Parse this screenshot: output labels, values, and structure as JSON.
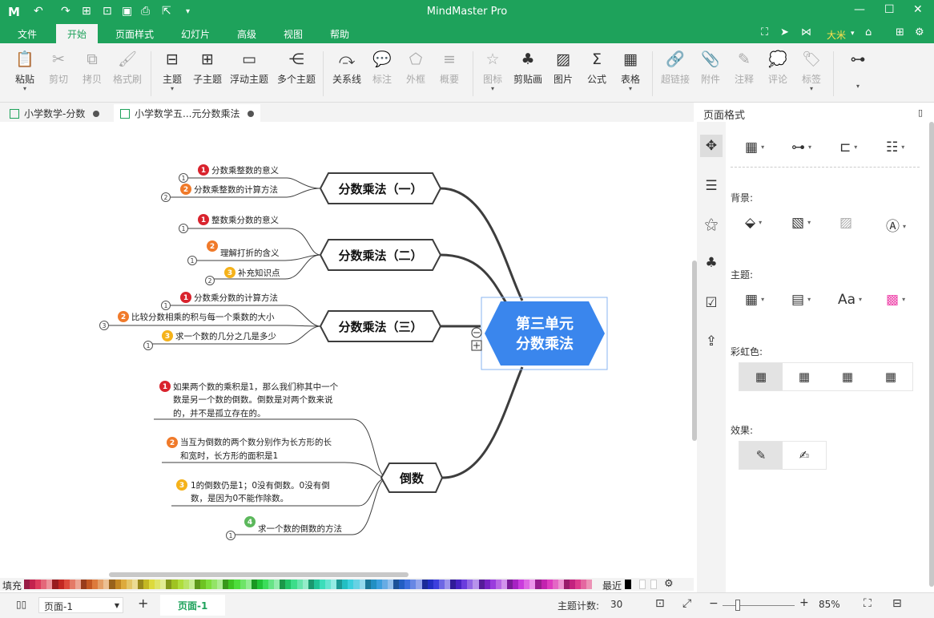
{
  "app": {
    "title": "MindMaster Pro",
    "user": "大米"
  },
  "menu": {
    "items": [
      "文件",
      "开始",
      "页面样式",
      "幻灯片",
      "高级",
      "视图",
      "帮助"
    ]
  },
  "ribbon": {
    "buttons": [
      "粘贴",
      "剪切",
      "拷贝",
      "格式刷",
      "主题",
      "子主题",
      "浮动主题",
      "多个主题",
      "关系线",
      "标注",
      "外框",
      "概要",
      "图标",
      "剪贴画",
      "图片",
      "公式",
      "表格",
      "超链接",
      "附件",
      "注释",
      "评论",
      "标签"
    ]
  },
  "tabs": [
    "小学数学-分数",
    "小学数学五...元分数乘法"
  ],
  "map": {
    "root": {
      "line1": "第三单元",
      "line2": "分数乘法"
    },
    "branches": [
      {
        "label": "分数乘法（一）",
        "items": [
          {
            "num": "1",
            "text": "分数乘整数的意义",
            "count": "1"
          },
          {
            "num": "2",
            "text": "分数乘整数的计算方法",
            "count": "2"
          }
        ]
      },
      {
        "label": "分数乘法（二）",
        "items": [
          {
            "num": "1",
            "text": "整数乘分数的意义",
            "count": "1"
          },
          {
            "num": "2",
            "text": "理解打折的含义",
            "count": "1"
          },
          {
            "num": "3",
            "text": "补充知识点",
            "count": "2"
          }
        ]
      },
      {
        "label": "分数乘法（三）",
        "items": [
          {
            "num": "1",
            "text": "分数乘分数的计算方法",
            "count": "1"
          },
          {
            "num": "2",
            "text": "比较分数相乘的积与每一个乘数的大小",
            "count": "3"
          },
          {
            "num": "3",
            "text": "求一个数的几分之几是多少",
            "count": "1"
          }
        ]
      },
      {
        "label": "倒数",
        "items": [
          {
            "num": "1",
            "lines": [
              "如果两个数的乘积是1，那么我们称其中一个",
              "数是另一个数的倒数。倒数是对两个数来说",
              "的，并不是孤立存在的。"
            ]
          },
          {
            "num": "2",
            "lines": [
              "当互为倒数的两个数分别作为长方形的长",
              "和宽时，长方形的面积是1"
            ]
          },
          {
            "num": "3",
            "lines": [
              "1的倒数仍是1；0没有倒数。0没有倒",
              "数，是因为0不能作除数。"
            ]
          },
          {
            "num": "4",
            "lines": [
              "求一个数的倒数的方法"
            ],
            "count": "1"
          }
        ]
      }
    ],
    "colors": {
      "root": "#3a86ed",
      "badge1": "#d9232d",
      "badge2": "#f07a2a",
      "badge3": "#f5b21a",
      "badge4": "#5cb85c",
      "line": "#3d3d3d"
    }
  },
  "palette": {
    "label": "填充",
    "recent": "最近"
  },
  "panel": {
    "title": "页面格式",
    "sections": {
      "bg": "背景:",
      "theme": "主题:",
      "rainbow": "彩虹色:",
      "effect": "效果:"
    }
  },
  "status": {
    "page_select": "页面-1",
    "page_tab": "页面-1",
    "count_label": "主题计数:",
    "count": "30",
    "zoom": "85%"
  }
}
